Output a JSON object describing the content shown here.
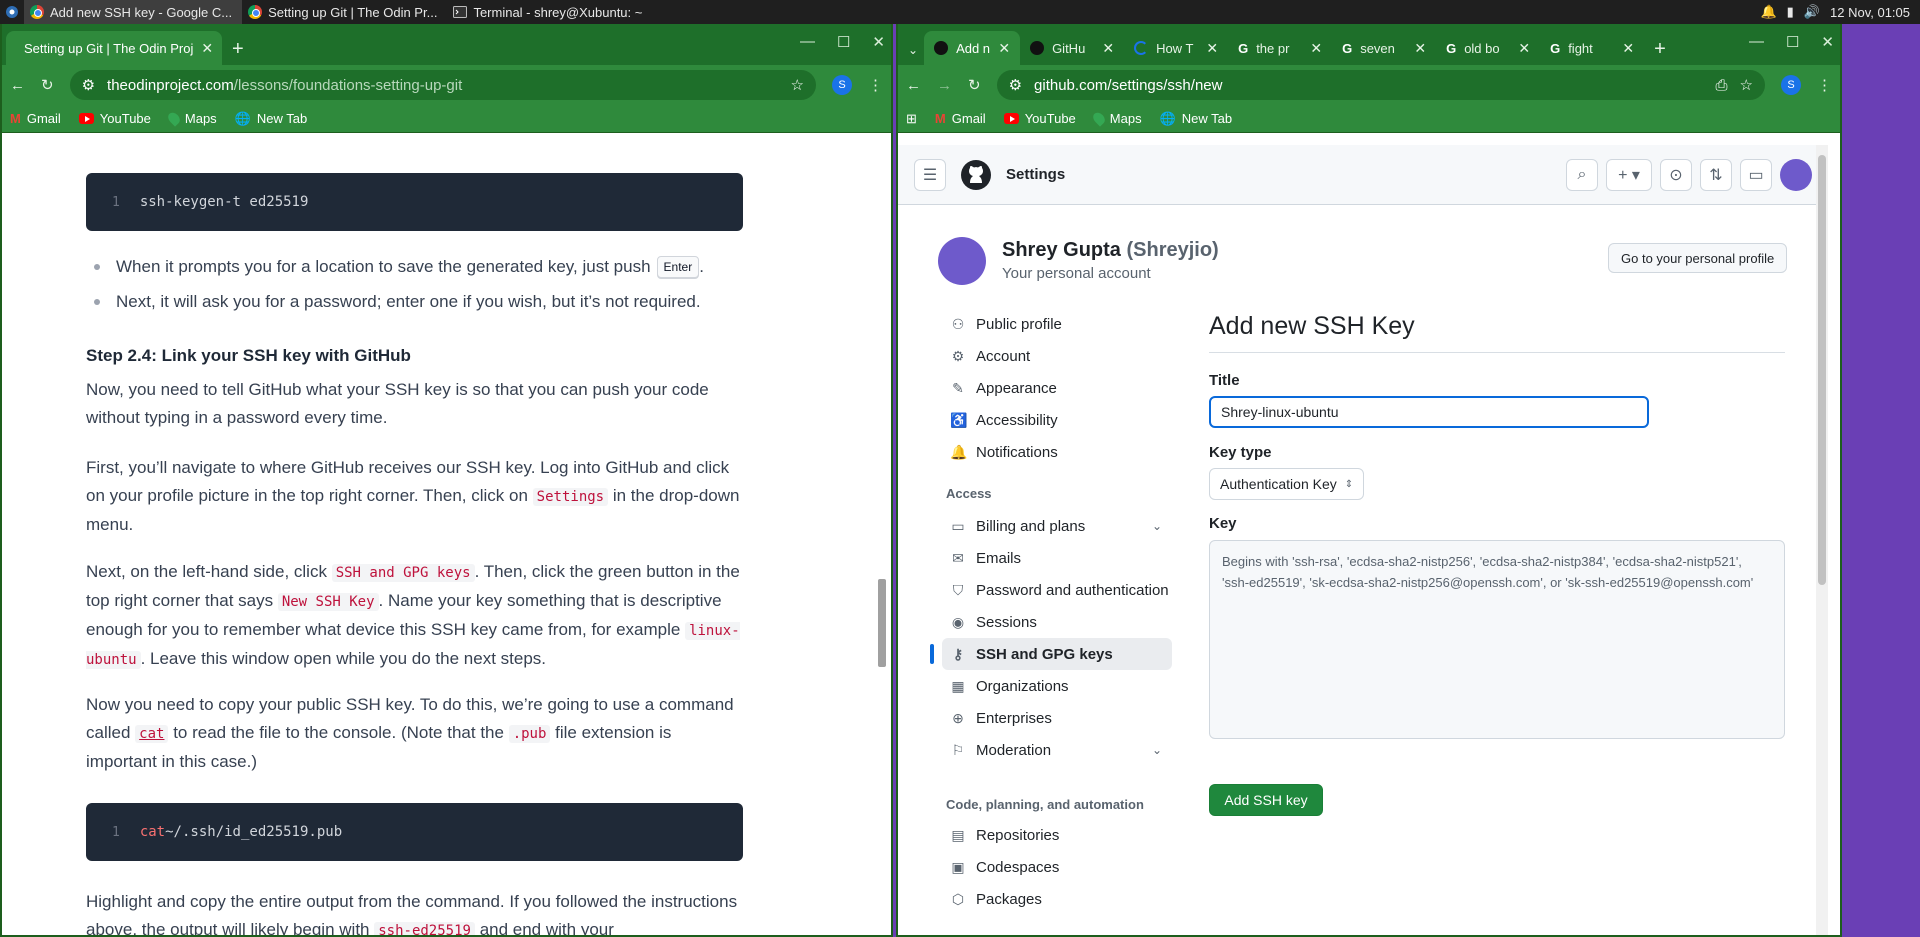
{
  "taskbar": {
    "tasks": [
      {
        "label": "Add new SSH key - Google C..."
      },
      {
        "label": "Setting up Git | The Odin Pr..."
      },
      {
        "label": "Terminal - shrey@Xubuntu: ~"
      }
    ],
    "clock": "12 Nov, 01:05"
  },
  "left_browser": {
    "tab_title": "Setting up Git | The Odin Proj",
    "url_host": "theodinproject.com",
    "url_path": "/lessons/foundations-setting-up-git",
    "profile_letter": "S",
    "bookmarks": [
      "Gmail",
      "YouTube",
      "Maps",
      "New Tab"
    ]
  },
  "article": {
    "code1_line": "1",
    "code1_cmd": "ssh-keygen",
    "code1_args": " -t ed25519",
    "bullet1": "When it prompts you for a location to save the generated key, just push",
    "bullet1_key": "Enter",
    "bullet1_end": ".",
    "bullet2": "Next, it will ask you for a password; enter one if you wish, but it’s not required.",
    "heading": "Step 2.4: Link your SSH key with GitHub",
    "p1": "Now, you need to tell GitHub what your SSH key is so that you can push your code without typing in a password every time.",
    "p2_a": "First, you’ll navigate to where GitHub receives our SSH key. Log into GitHub and click on your profile picture in the top right corner. Then, click on",
    "p2_code": "Settings",
    "p2_b": "in the drop-down menu.",
    "p3_a": "Next, on the left-hand side, click",
    "p3_code1": "SSH and GPG keys",
    "p3_b": ". Then, click the green button in the top right corner that says",
    "p3_code2": "New SSH Key",
    "p3_c": ". Name your key something that is descriptive enough for you to remember what device this SSH key came from, for example",
    "p3_code3": "linux-ubuntu",
    "p3_d": ". Leave this window open while you do the next steps.",
    "p4_a": "Now you need to copy your public SSH key. To do this, we’re going to use a command called",
    "p4_code1": "cat",
    "p4_b": "to read the file to the console. (Note that the",
    "p4_code2": ".pub",
    "p4_c": "file extension is important in this case.)",
    "code2_line": "1",
    "code2_cmd": "cat",
    "code2_args": " ~/.ssh/id_ed25519.pub",
    "p5_a": "Highlight and copy the entire output from the command. If you followed the instructions above, the output will likely begin with",
    "p5_code": "ssh-ed25519",
    "p5_b": "and end with your"
  },
  "right_browser": {
    "tabs": [
      {
        "label": "Add n",
        "active": true
      },
      {
        "label": "GitHu"
      },
      {
        "label": "How T"
      },
      {
        "label": "the pr"
      },
      {
        "label": "seven"
      },
      {
        "label": "old bo"
      },
      {
        "label": "fight"
      }
    ],
    "url": "github.com/settings/ssh/new",
    "profile_letter": "S",
    "bookmarks": [
      "Gmail",
      "YouTube",
      "Maps",
      "New Tab"
    ]
  },
  "github": {
    "header_title": "Settings",
    "user_name": "Shrey Gupta",
    "user_handle": "(Shreyjio)",
    "user_sub": "Your personal account",
    "profile_button": "Go to your personal profile",
    "nav_top": [
      {
        "label": "Public profile",
        "icon": "person-icon"
      },
      {
        "label": "Account",
        "icon": "gear-icon"
      },
      {
        "label": "Appearance",
        "icon": "paintbrush-icon"
      },
      {
        "label": "Accessibility",
        "icon": "accessibility-icon"
      },
      {
        "label": "Notifications",
        "icon": "bell-icon"
      }
    ],
    "nav_access_title": "Access",
    "nav_access": [
      {
        "label": "Billing and plans",
        "icon": "credit-card-icon"
      },
      {
        "label": "Emails",
        "icon": "mail-icon"
      },
      {
        "label": "Password and authentication",
        "icon": "shield-icon"
      },
      {
        "label": "Sessions",
        "icon": "broadcast-icon"
      },
      {
        "label": "SSH and GPG keys",
        "icon": "key-icon"
      },
      {
        "label": "Organizations",
        "icon": "table-icon"
      },
      {
        "label": "Enterprises",
        "icon": "globe-icon"
      },
      {
        "label": "Moderation",
        "icon": "report-icon"
      }
    ],
    "nav_code_title": "Code, planning, and automation",
    "nav_code": [
      {
        "label": "Repositories",
        "icon": "repo-icon"
      },
      {
        "label": "Codespaces",
        "icon": "codespaces-icon"
      },
      {
        "label": "Packages",
        "icon": "package-icon"
      }
    ],
    "form_title": "Add new SSH Key",
    "title_label": "Title",
    "title_value": "Shrey-linux-ubuntu",
    "keytype_label": "Key type",
    "keytype_value": "Authentication Key",
    "key_label": "Key",
    "key_placeholder": "Begins with 'ssh-rsa', 'ecdsa-sha2-nistp256', 'ecdsa-sha2-nistp384', 'ecdsa-sha2-nistp521', 'ssh-ed25519', 'sk-ecdsa-sha2-nistp256@openssh.com', or 'sk-ssh-ed25519@openssh.com'",
    "submit_label": "Add SSH key"
  },
  "colors": {
    "browser_frame": "#2f8a3c",
    "github_green": "#1f883d",
    "selected_accent": "#0969da",
    "desktop": "#6a3fb5"
  }
}
